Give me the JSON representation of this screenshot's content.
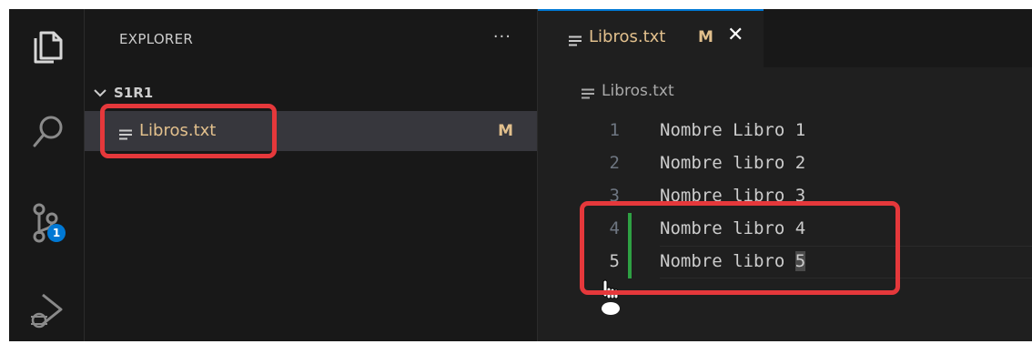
{
  "activity_bar": {
    "icons": [
      "files-icon",
      "search-icon",
      "source-control-icon",
      "run-debug-icon"
    ],
    "source_control_badge": "1",
    "accent": "#0078d4"
  },
  "sidebar": {
    "title": "EXPLORER",
    "more_label": "···",
    "folder": {
      "label": "S1R1"
    },
    "file": {
      "name": "Libros.txt",
      "status": "M"
    }
  },
  "editor": {
    "tab": {
      "label": "Libros.txt",
      "status": "M",
      "close": "✕"
    },
    "breadcrumb": "Libros.txt",
    "lines": [
      {
        "number": "1",
        "text": "Nombre Libro 1"
      },
      {
        "number": "2",
        "text": "Nombre libro 2"
      },
      {
        "number": "3",
        "text": "Nombre libro 3"
      },
      {
        "number": "4",
        "text": "Nombre libro 4"
      },
      {
        "number": "5",
        "text_before": "Nombre libro ",
        "text_selected": "5"
      }
    ],
    "added_line_color": "#2ea043",
    "modified_color": "#e2c08d"
  },
  "highlight_color": "#e5383b"
}
